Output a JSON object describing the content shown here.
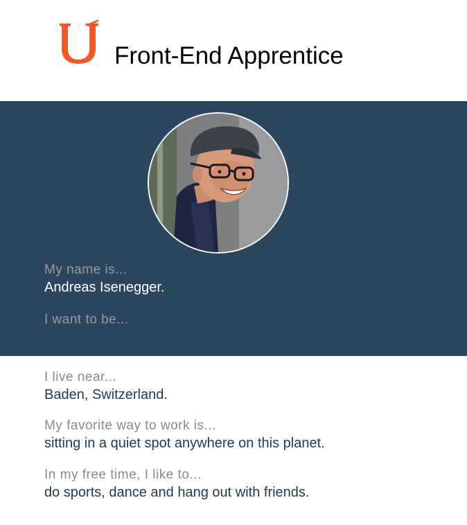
{
  "header": {
    "logo_icon": "udacity-u-logo-icon",
    "logo_color": "#f15a24",
    "title": "Front-End Apprentice"
  },
  "hero": {
    "background": "#2b475f",
    "avatar_icon": "profile-photo",
    "name_label": "My name is...",
    "name_value": "Andreas Isenegger.",
    "goal_label": "I want to be..."
  },
  "details": [
    {
      "label": "I live near...",
      "value": "Baden, Switzerland."
    },
    {
      "label": "My favorite way to work is...",
      "value": "sitting in a quiet spot anywhere on this planet."
    },
    {
      "label": "In my free time, I like to...",
      "value": "do sports, dance and hang out with friends."
    }
  ]
}
